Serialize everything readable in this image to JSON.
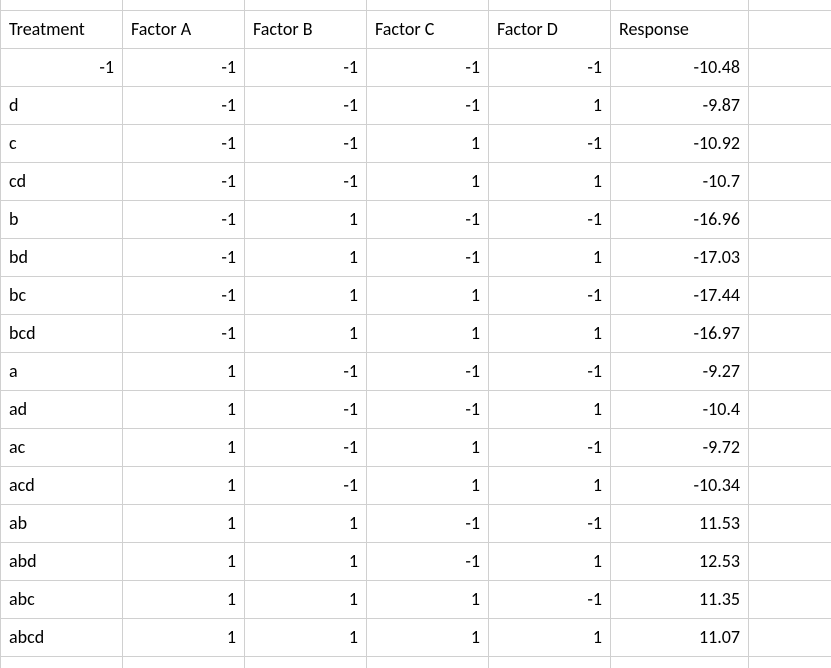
{
  "headers": {
    "treatment": "Treatment",
    "factorA": "Factor A",
    "factorB": "Factor B",
    "factorC": "Factor C",
    "factorD": "Factor D",
    "response": "Response"
  },
  "rows": [
    {
      "treatment": "-1",
      "treatment_numeric": true,
      "a": "-1",
      "b": "-1",
      "c": "-1",
      "d": "-1",
      "resp": "-10.48"
    },
    {
      "treatment": "d",
      "a": "-1",
      "b": "-1",
      "c": "-1",
      "d": "1",
      "resp": "-9.87"
    },
    {
      "treatment": "c",
      "a": "-1",
      "b": "-1",
      "c": "1",
      "d": "-1",
      "resp": "-10.92"
    },
    {
      "treatment": "cd",
      "a": "-1",
      "b": "-1",
      "c": "1",
      "d": "1",
      "resp": "-10.7"
    },
    {
      "treatment": "b",
      "a": "-1",
      "b": "1",
      "c": "-1",
      "d": "-1",
      "resp": "-16.96"
    },
    {
      "treatment": "bd",
      "a": "-1",
      "b": "1",
      "c": "-1",
      "d": "1",
      "resp": "-17.03"
    },
    {
      "treatment": "bc",
      "a": "-1",
      "b": "1",
      "c": "1",
      "d": "-1",
      "resp": "-17.44"
    },
    {
      "treatment": "bcd",
      "a": "-1",
      "b": "1",
      "c": "1",
      "d": "1",
      "resp": "-16.97"
    },
    {
      "treatment": "a",
      "a": "1",
      "b": "-1",
      "c": "-1",
      "d": "-1",
      "resp": "-9.27"
    },
    {
      "treatment": "ad",
      "a": "1",
      "b": "-1",
      "c": "-1",
      "d": "1",
      "resp": "-10.4"
    },
    {
      "treatment": "ac",
      "a": "1",
      "b": "-1",
      "c": "1",
      "d": "-1",
      "resp": "-9.72"
    },
    {
      "treatment": "acd",
      "a": "1",
      "b": "-1",
      "c": "1",
      "d": "1",
      "resp": "-10.34"
    },
    {
      "treatment": "ab",
      "a": "1",
      "b": "1",
      "c": "-1",
      "d": "-1",
      "resp": "11.53"
    },
    {
      "treatment": "abd",
      "a": "1",
      "b": "1",
      "c": "-1",
      "d": "1",
      "resp": "12.53"
    },
    {
      "treatment": "abc",
      "a": "1",
      "b": "1",
      "c": "1",
      "d": "-1",
      "resp": "11.35"
    },
    {
      "treatment": "abcd",
      "a": "1",
      "b": "1",
      "c": "1",
      "d": "1",
      "resp": "11.07"
    }
  ]
}
